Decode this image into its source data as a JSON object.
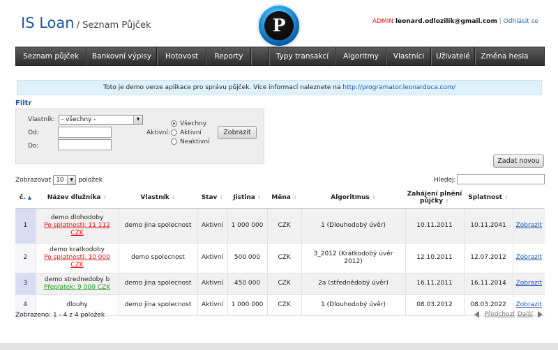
{
  "header": {
    "app_name": "IS Loan",
    "subtitle": "/ Seznam Půjček",
    "logo_letter": "P",
    "user_role": "ADMIN",
    "user_email": "leonard.odlozilik@gmail.com",
    "separator": "|",
    "logout_label": "Odhlásit se"
  },
  "nav": {
    "items": [
      {
        "label": "Seznam půjček"
      },
      {
        "label": "Bankovní výpisy"
      },
      {
        "label": "Hotovost"
      },
      {
        "label": "Reporty"
      },
      {
        "label": ""
      },
      {
        "label": "Typy transakcí"
      },
      {
        "label": "Algoritmy"
      },
      {
        "label": "Vlastníci"
      },
      {
        "label": "Uživatelé"
      },
      {
        "label": "Změna hesla"
      }
    ]
  },
  "info": {
    "text": "Toto je demo verze aplikace pro správu půjček. Více informací naleznete na",
    "link": "http://programator.leonardoca.com/"
  },
  "filter": {
    "title": "Filtr",
    "owner_label": "Vlastník:",
    "owner_value": "- všechny -",
    "from_label": "Od:",
    "to_label": "Do:",
    "active_label": "Aktivní:",
    "radio_options": [
      "Všechny",
      "Aktivní",
      "Neaktivní"
    ],
    "radio_selected": "Všechny",
    "show_button": "Zobrazit"
  },
  "add_new_button": "Zadat novou",
  "table_controls": {
    "show_prefix": "Zobrazovat",
    "page_size": "10",
    "show_suffix": "položek",
    "search_label": "Hledej:",
    "search_value": ""
  },
  "table": {
    "columns": [
      "č.",
      "Název dlužníka",
      "Vlastník",
      "Stav",
      "Jistina",
      "Měna",
      "Algoritmus",
      "Zahájení plnění půjčky",
      "Splatnost",
      ""
    ],
    "rows": [
      {
        "num": "1",
        "name": "demo dlohodoby",
        "name_note": "Po splatnosti: 11 112 CZK",
        "note_type": "red",
        "owner": "demo jina spolecnost",
        "status": "Aktivní",
        "principal": "1 000 000",
        "currency": "CZK",
        "algorithm": "1 (Dlouhodobý úvěr)",
        "start": "10.11.2011",
        "due": "10.11.2041",
        "action": "Zobrazit"
      },
      {
        "num": "2",
        "name": "demo kratkodoby",
        "name_note": "Po splatnosti: 10 000 CZK",
        "note_type": "red",
        "owner": "demo spolecnost",
        "status": "Aktivní",
        "principal": "500 000",
        "currency": "CZK",
        "algorithm": "3_2012 (Krátkodobý úvěr 2012)",
        "start": "12.10.2011",
        "due": "12.07.2012",
        "action": "Zobrazit"
      },
      {
        "num": "3",
        "name": "demo strednedoby b",
        "name_note": "Přeplatek: 9 000 CZK",
        "note_type": "green",
        "owner": "demo jina spolecnost",
        "status": "Aktivní",
        "principal": "450 000",
        "currency": "CZK",
        "algorithm": "2a (střednědobý úvěr)",
        "start": "16.11.2011",
        "due": "16.11.2014",
        "action": "Zobrazit"
      },
      {
        "num": "4",
        "name": "dlouhy",
        "name_note": "",
        "note_type": "",
        "owner": "demo jina spolecnost",
        "status": "Aktivní",
        "principal": "1 000 000",
        "currency": "CZK",
        "algorithm": "1 (Dlouhodobý úvěr)",
        "start": "08.03.2012",
        "due": "08.03.2022",
        "action": "Zobrazit"
      }
    ]
  },
  "footer": {
    "summary": "Zobrazeno: 1 - 4 z 4 položek",
    "prev": "Předchozí",
    "next": "Další"
  },
  "colors": {
    "brand_blue": "#1f56a8",
    "nav_dark": "#2d2d2d",
    "overdue_red": "#e11111",
    "overpay_green": "#2a9a2a",
    "info_bg": "#dff2fb"
  }
}
